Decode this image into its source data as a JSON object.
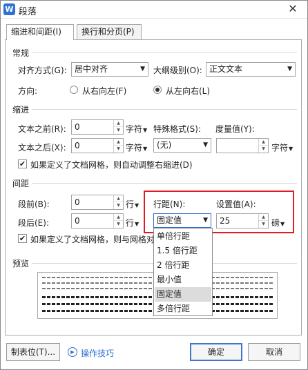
{
  "window": {
    "title": "段落",
    "app_logo_letter": "W",
    "close_glyph": "✕"
  },
  "tabs": [
    {
      "label": "缩进和间距(I)",
      "active": true
    },
    {
      "label": "换行和分页(P)",
      "active": false
    }
  ],
  "general": {
    "section": "常规",
    "alignment_label": "对齐方式(G):",
    "alignment_value": "居中对齐",
    "outline_label": "大纲级别(O):",
    "outline_value": "正文文本",
    "direction_label": "方向:",
    "rtl_label": "从右向左(F)",
    "ltr_label": "从左向右(L)",
    "direction_selected": "ltr"
  },
  "indent": {
    "section": "缩进",
    "before_label": "文本之前(R):",
    "before_value": "0",
    "before_unit": "字符",
    "after_label": "文本之后(X):",
    "after_value": "0",
    "after_unit": "字符",
    "special_label": "特殊格式(S):",
    "special_value": "(无)",
    "measure_label": "度量值(Y):",
    "measure_value": "",
    "measure_unit": "字符",
    "grid_checkbox": "如果定义了文档网格，则自动调整右缩进(D)",
    "grid_checked": true
  },
  "spacing": {
    "section": "间距",
    "before_label": "段前(B):",
    "before_value": "0",
    "before_unit": "行",
    "after_label": "段后(E):",
    "after_value": "0",
    "after_unit": "行",
    "line_label": "行距(N):",
    "line_value": "固定值",
    "setting_label": "设置值(A):",
    "setting_value": "25",
    "setting_unit": "磅",
    "grid_checkbox": "如果定义了文档网格，则与网格对齐",
    "grid_checked": true,
    "line_options": [
      "单倍行距",
      "1.5 倍行距",
      "2 倍行距",
      "最小值",
      "固定值",
      "多倍行距"
    ],
    "selected_option": "固定值"
  },
  "preview": {
    "section": "预览"
  },
  "buttons": {
    "tabs": "制表位(T)...",
    "tips": "操作技巧",
    "ok": "确定",
    "cancel": "取消"
  },
  "colors": {
    "highlight": "#e01c24",
    "primary_border": "#3f78c8",
    "link": "#2f6fd0",
    "logo": "#2e73d2"
  },
  "icons": {
    "dropdown": "triangle-down",
    "spin_up": "triangle-up",
    "spin_down": "triangle-down",
    "tips": "play-circle"
  }
}
